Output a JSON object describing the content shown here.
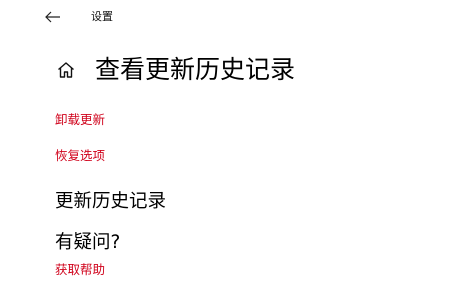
{
  "window": {
    "title": "设置",
    "back_icon": "arrow-left-icon"
  },
  "header": {
    "home_icon": "home-icon",
    "title": "查看更新历史记录"
  },
  "links": {
    "uninstall_updates": "卸载更新",
    "recovery_options": "恢复选项"
  },
  "update_history": {
    "heading": "更新历史记录"
  },
  "help_section": {
    "heading": "有疑问?",
    "link": "获取帮助"
  },
  "colors": {
    "link": "#d0021b",
    "text": "#000000",
    "background": "#ffffff"
  }
}
